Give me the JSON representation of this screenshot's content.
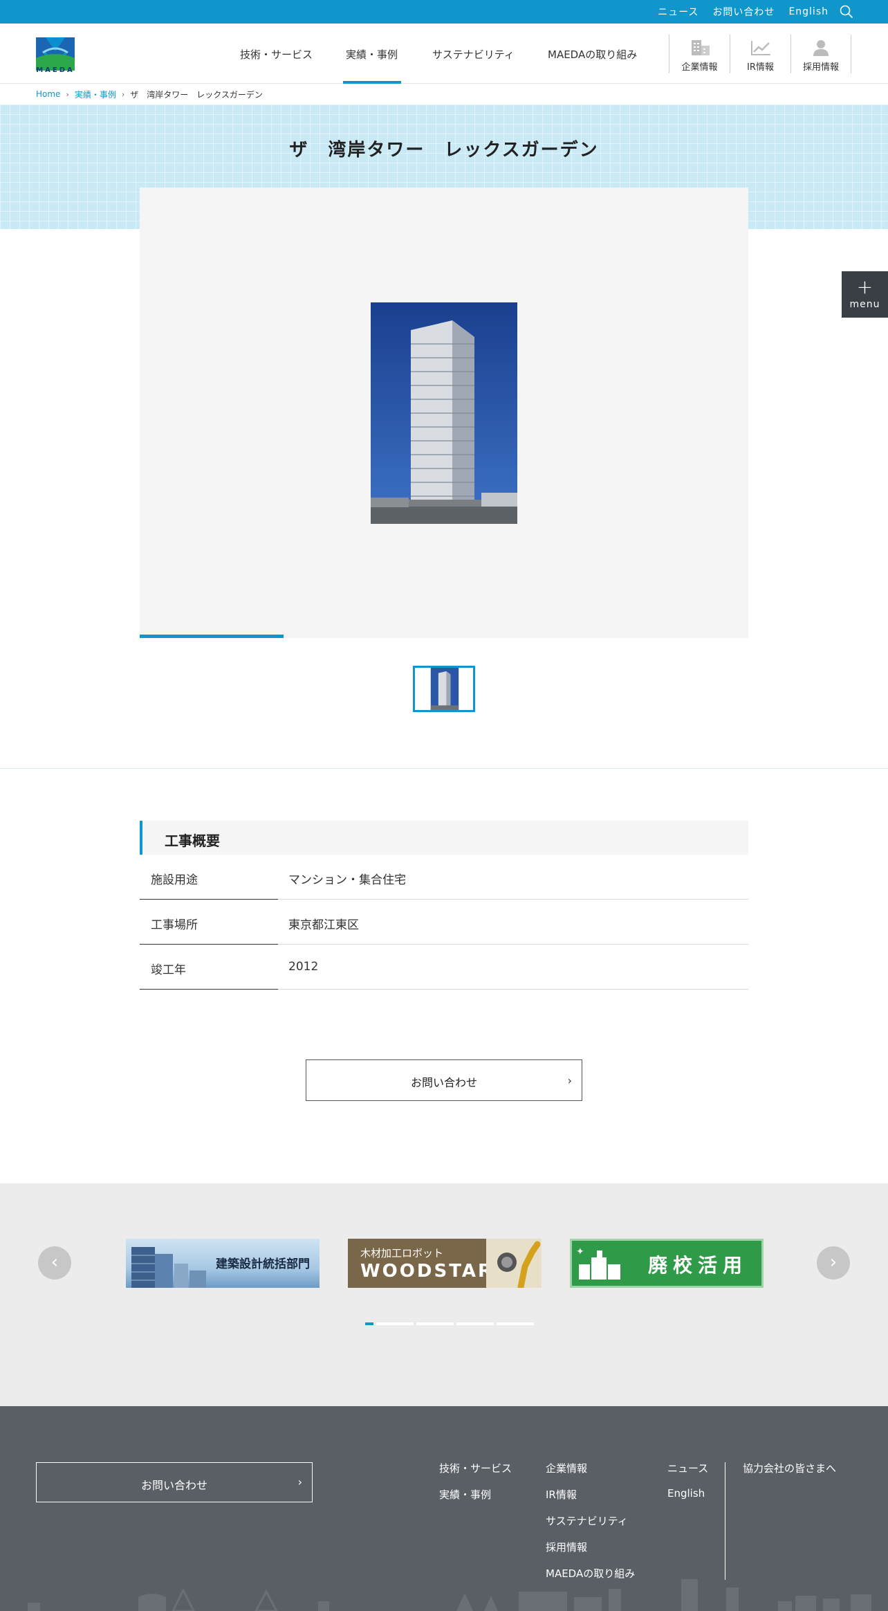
{
  "topbar": {
    "links": [
      "ニュース",
      "お問い合わせ",
      "English"
    ],
    "search_icon": "search-icon"
  },
  "header": {
    "logo_text": "MAEDA",
    "nav": [
      "技術・サービス",
      "実績・事例",
      "サステナビリティ",
      "MAEDAの取り組み"
    ],
    "active_nav": "実績・事例",
    "icon_links": [
      {
        "label": "企業情報",
        "icon": "building-icon"
      },
      {
        "label": "IR情報",
        "icon": "chart-icon"
      },
      {
        "label": "採用情報",
        "icon": "person-icon"
      }
    ]
  },
  "breadcrumb": {
    "home": "Home",
    "category": "実績・事例",
    "current": "ザ　湾岸タワー　レックスガーデン"
  },
  "page": {
    "title": "ザ　湾岸タワー　レックスガーデン"
  },
  "menu_button": {
    "label": "menu"
  },
  "gallery": {
    "slide_count": 1,
    "current_slide": 1
  },
  "overview": {
    "heading": "工事概要",
    "rows": [
      {
        "key": "施設用途",
        "value": "マンション・集合住宅"
      },
      {
        "key": "工事場所",
        "value": "東京都江東区"
      },
      {
        "key": "竣工年",
        "value": "2012"
      }
    ]
  },
  "contact_button": {
    "label": "お問い合わせ"
  },
  "banners": {
    "items": [
      {
        "text": "建築設計統括部門"
      },
      {
        "text_top": "木材加工ロボット",
        "text_main": "WOODSTAR"
      },
      {
        "text": "廃校活用"
      }
    ],
    "page_count": 5,
    "active_page": 1
  },
  "footer": {
    "contact_label": "お問い合わせ",
    "col1": [
      "技術・サービス",
      "実績・事例"
    ],
    "col2": [
      "企業情報",
      "IR情報",
      "サステナビリティ",
      "採用情報",
      "MAEDAの取り組み"
    ],
    "col3": [
      "ニュース",
      "English"
    ],
    "col4": [
      "協力会社の皆さまへ"
    ]
  },
  "colors": {
    "accent": "#0f97cc",
    "footer_bg": "#5a5f66",
    "banner_bg": "#ececec",
    "hero_bg": "#c9e9f5"
  }
}
